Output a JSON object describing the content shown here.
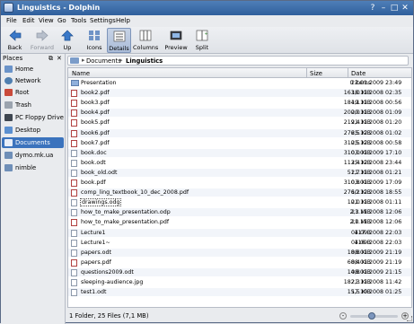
{
  "window": {
    "title": "Linguistics - Dolphin"
  },
  "menu": [
    "File",
    "Edit",
    "View",
    "Go",
    "Tools",
    "Settings",
    "Help"
  ],
  "toolbar": {
    "back": "Back",
    "forward": "Forward",
    "up": "Up",
    "icons": "Icons",
    "details": "Details",
    "columns": "Columns",
    "preview": "Preview",
    "split": "Split"
  },
  "places": {
    "title": "Places",
    "items": [
      "Home",
      "Network",
      "Root",
      "Trash",
      "PC Floppy Drive",
      "Desktop",
      "Documents",
      "dymo.mk.ua",
      "nimble"
    ],
    "selected": "Documents"
  },
  "breadcrumb": {
    "parent": "Documents",
    "current": "Linguistics"
  },
  "columns": {
    "name": "Name",
    "size": "Size",
    "date": "Date"
  },
  "files": [
    {
      "name": "Presentation",
      "size": "0 items",
      "date": "22.01.2009 23:49",
      "type": "folder"
    },
    {
      "name": "book2.pdf",
      "size": "163,0 KiB",
      "date": "18.11.2008 02:35",
      "type": "pdf"
    },
    {
      "name": "book3.pdf",
      "size": "184,1 KiB",
      "date": "19.11.2008 00:56",
      "type": "pdf"
    },
    {
      "name": "book4.pdf",
      "size": "200,0 KiB",
      "date": "20.11.2008 01:09",
      "type": "pdf"
    },
    {
      "name": "book5.pdf",
      "size": "219,4 KiB",
      "date": "21.11.2008 01:20",
      "type": "pdf"
    },
    {
      "name": "book6.pdf",
      "size": "276,5 KiB",
      "date": "25.12.2008 01:02",
      "type": "pdf"
    },
    {
      "name": "book7.pdf",
      "size": "310,5 KiB",
      "date": "25.12.2008 00:58",
      "type": "pdf"
    },
    {
      "name": "book.doc",
      "size": "310,0 KiB",
      "date": "03.01.2009 17:10",
      "type": "doc"
    },
    {
      "name": "book.odt",
      "size": "113,4 KiB",
      "date": "25.12.2008 23:44",
      "type": "doc"
    },
    {
      "name": "book_old.odt",
      "size": "51,7 KiB",
      "date": "21.11.2008 01:21",
      "type": "doc"
    },
    {
      "name": "book.pdf",
      "size": "310,8 KiB",
      "date": "03.01.2009 17:09",
      "type": "pdf"
    },
    {
      "name": "comp_ling_textbook_10_dec_2008.pdf",
      "size": "276,2 KiB",
      "date": "10.12.2008 18:55",
      "type": "pdf"
    },
    {
      "name": "drawings.odg",
      "size": "10,0 KiB",
      "date": "21.11.2008 01:11",
      "type": "doc",
      "focus": true
    },
    {
      "name": "how_to_make_presentation.odp",
      "size": "2,3 MiB",
      "date": "21.11.2008 12:06",
      "type": "doc"
    },
    {
      "name": "how_to_make_presentation.pdf",
      "size": "2,0 MiB",
      "date": "21.11.2008 12:06",
      "type": "pdf"
    },
    {
      "name": "Lecture1",
      "size": "117 B",
      "date": "04.09.2008 22:03",
      "type": "doc"
    },
    {
      "name": "Lecture1~",
      "size": "116 B",
      "date": "04.09.2008 22:03",
      "type": "doc"
    },
    {
      "name": "papers.odt",
      "size": "18,8 KiB",
      "date": "08.01.2009 21:19",
      "type": "doc"
    },
    {
      "name": "papers.pdf",
      "size": "68,4 KiB",
      "date": "08.01.2009 21:19",
      "type": "pdf"
    },
    {
      "name": "questions2009.odt",
      "size": "14,8 KiB",
      "date": "08.01.2009 21:15",
      "type": "doc"
    },
    {
      "name": "sleeping-audience.jpg",
      "size": "182,3 KiB",
      "date": "21.11.2008 11:42",
      "type": "image"
    },
    {
      "name": "test1.odt",
      "size": "15,5 KiB",
      "date": "17.10.2008 01:25",
      "type": "doc"
    }
  ],
  "status": {
    "text": "1 Folder, 25 Files (7,1 MB)",
    "zoom_fraction": 0.45
  }
}
